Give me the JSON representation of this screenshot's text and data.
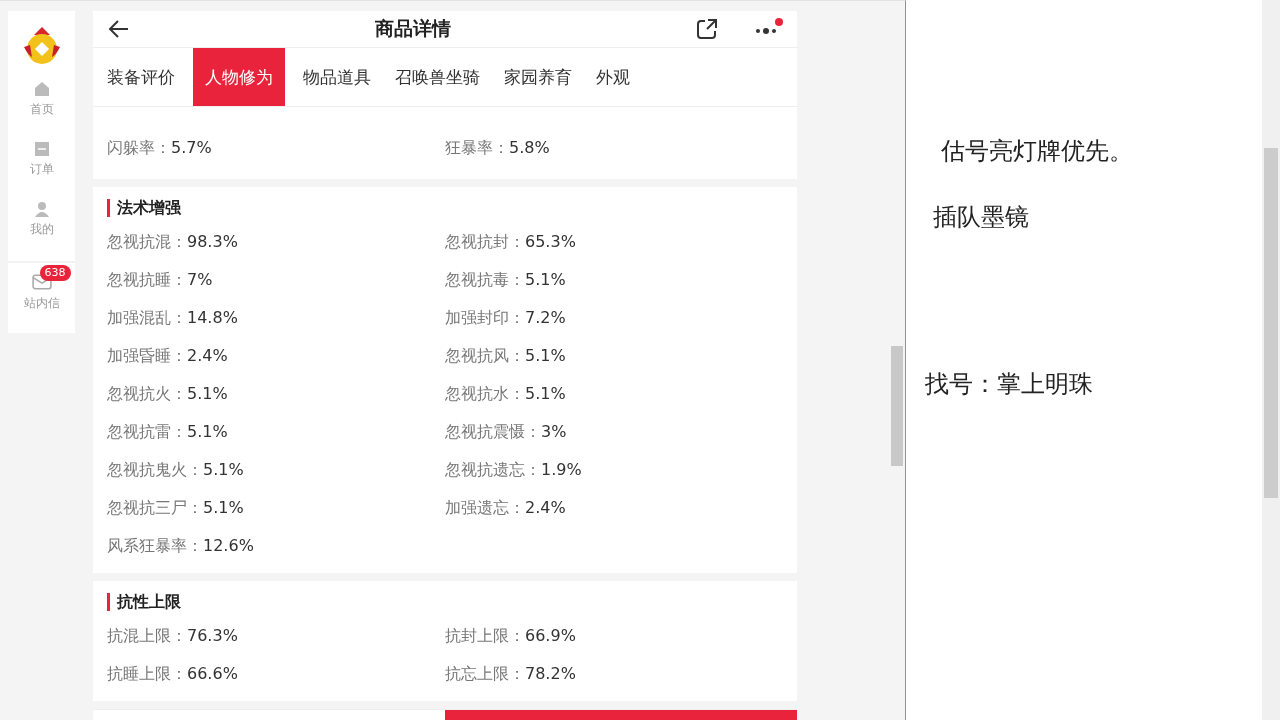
{
  "sidebar": {
    "items": [
      {
        "label": "首页"
      },
      {
        "label": "订单"
      },
      {
        "label": "我的"
      },
      {
        "label": "站内信",
        "badge": "638"
      }
    ]
  },
  "header": {
    "title": "商品详情"
  },
  "tabs": [
    {
      "label": "装备评价",
      "selected": false
    },
    {
      "label": "人物修为",
      "selected": true
    },
    {
      "label": "物品道具",
      "selected": false
    },
    {
      "label": "召唤兽坐骑",
      "selected": false
    },
    {
      "label": "家园养育",
      "selected": false
    },
    {
      "label": "外观",
      "selected": false
    }
  ],
  "sections": [
    {
      "stats": [
        {
          "label": "闪躲率：",
          "value": "5.7%"
        },
        {
          "label": "狂暴率：",
          "value": "5.8%"
        }
      ]
    },
    {
      "title": "法术增强",
      "stats": [
        {
          "label": "忽视抗混：",
          "value": "98.3%"
        },
        {
          "label": "忽视抗封：",
          "value": "65.3%"
        },
        {
          "label": "忽视抗睡：",
          "value": "7%"
        },
        {
          "label": "忽视抗毒：",
          "value": "5.1%"
        },
        {
          "label": "加强混乱：",
          "value": "14.8%"
        },
        {
          "label": "加强封印：",
          "value": "7.2%"
        },
        {
          "label": "加强昏睡：",
          "value": "2.4%"
        },
        {
          "label": "忽视抗风：",
          "value": "5.1%"
        },
        {
          "label": "忽视抗火：",
          "value": "5.1%"
        },
        {
          "label": "忽视抗水：",
          "value": "5.1%"
        },
        {
          "label": "忽视抗雷：",
          "value": "5.1%"
        },
        {
          "label": "忽视抗震慑：",
          "value": "3%"
        },
        {
          "label": "忽视抗鬼火：",
          "value": "5.1%"
        },
        {
          "label": "忽视抗遗忘：",
          "value": "1.9%"
        },
        {
          "label": "忽视抗三尸：",
          "value": "5.1%"
        },
        {
          "label": "加强遗忘：",
          "value": "2.4%"
        },
        {
          "label": "风系狂暴率：",
          "value": "12.6%"
        }
      ]
    },
    {
      "title": "抗性上限",
      "stats": [
        {
          "label": "抗混上限：",
          "value": "76.3%"
        },
        {
          "label": "抗封上限：",
          "value": "66.9%"
        },
        {
          "label": "抗睡上限：",
          "value": "66.6%"
        },
        {
          "label": "抗忘上限：",
          "value": "78.2%"
        }
      ]
    }
  ],
  "notes": [
    "估号亮灯牌优先。",
    "插队墨镜",
    "找号：掌上明珠"
  ]
}
